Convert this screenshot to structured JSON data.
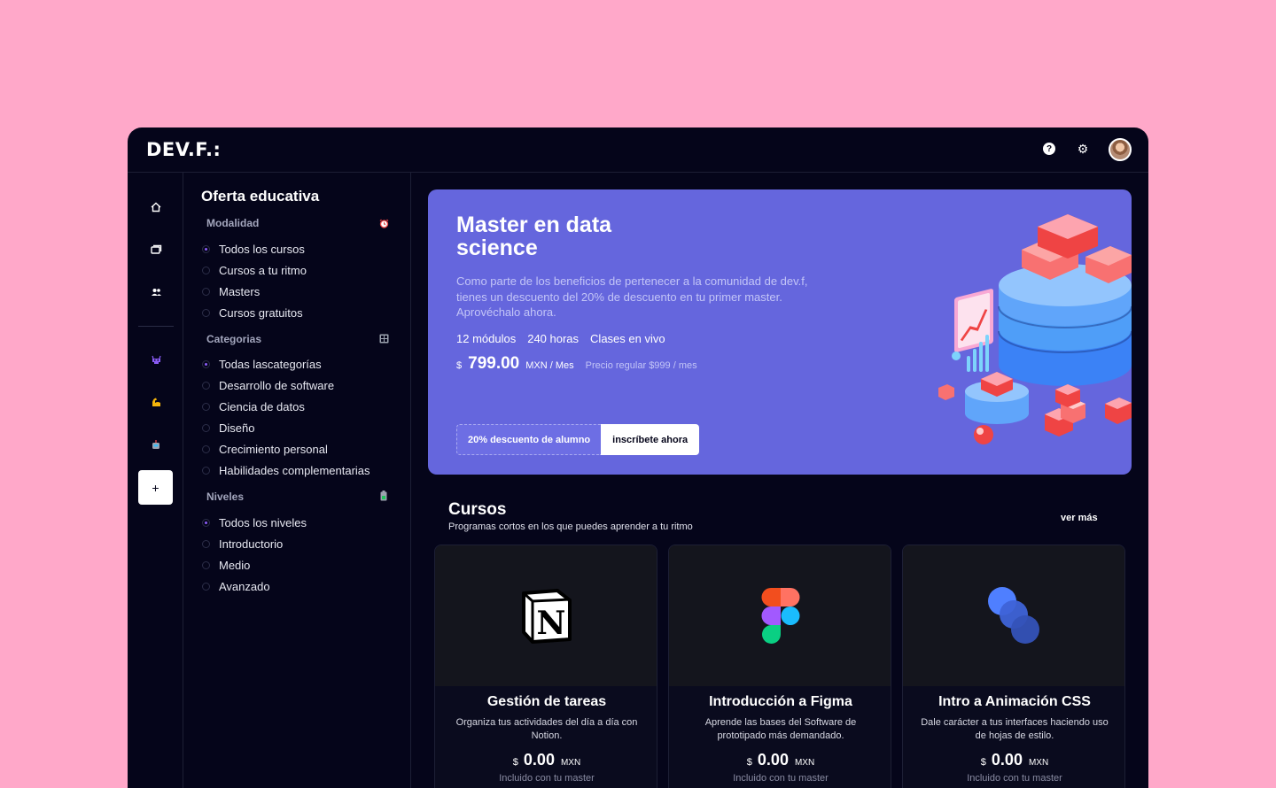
{
  "brand": {
    "logo_text": "DEV.F.:"
  },
  "topbar": {
    "icons": [
      "help-icon",
      "gear-icon",
      "avatar"
    ]
  },
  "rail": {
    "items": [
      "home-icon",
      "courses-icon",
      "community-icon",
      "alien-icon",
      "muscle-icon",
      "robot-icon"
    ],
    "add_label": "+"
  },
  "filters": {
    "title": "Oferta educativa",
    "sections": [
      {
        "label": "Modalidad",
        "icon": "alarm-clock-icon",
        "options": [
          {
            "label": "Todos los cursos",
            "selected": true
          },
          {
            "label": "Cursos a tu ritmo",
            "selected": false
          },
          {
            "label": "Masters",
            "selected": false
          },
          {
            "label": "Cursos gratuitos",
            "selected": false
          }
        ]
      },
      {
        "label": "Categorias",
        "icon": "grid-icon",
        "options": [
          {
            "label": "Todas lascategorías",
            "selected": true
          },
          {
            "label": "Desarrollo de software",
            "selected": false
          },
          {
            "label": "Ciencia de datos",
            "selected": false
          },
          {
            "label": "Diseño",
            "selected": false
          },
          {
            "label": "Crecimiento personal",
            "selected": false
          },
          {
            "label": "Habilidades complementarias",
            "selected": false
          }
        ]
      },
      {
        "label": "Niveles",
        "icon": "battery-icon",
        "options": [
          {
            "label": "Todos los niveles",
            "selected": true
          },
          {
            "label": "Introductorio",
            "selected": false
          },
          {
            "label": "Medio",
            "selected": false
          },
          {
            "label": "Avanzado",
            "selected": false
          }
        ]
      }
    ]
  },
  "hero": {
    "title": "Master en data science",
    "description": "Como parte de los beneficios de pertenecer a la comunidad de dev.f, tienes un descuento del 20% de descuento en tu primer master. Aprovéchalo ahora.",
    "meta": [
      "12 módulos",
      "240 horas",
      "Clases en vivo"
    ],
    "price": {
      "currency_symbol": "$",
      "amount": "799.00",
      "unit": "MXN / Mes",
      "regular": "Precio regular $999 / mes"
    },
    "badge": "20% descuento de alumno",
    "cta": "inscríbete ahora",
    "colors": {
      "background": "#6566dd"
    }
  },
  "courses": {
    "title": "Cursos",
    "subtitle": "Programas cortos en los que puedes aprender a tu ritmo",
    "see_more": "ver más",
    "items": [
      {
        "logo": "notion-logo",
        "title": "Gestión de tareas",
        "description": "Organiza tus actividades del día a día con Notion.",
        "currency_symbol": "$",
        "price": "0.00",
        "unit": "MXN",
        "note": "Incluido con tu master"
      },
      {
        "logo": "figma-logo",
        "title": "Introducción a Figma",
        "description": "Aprende las bases del Software de prototipado más demandado.",
        "currency_symbol": "$",
        "price": "0.00",
        "unit": "MXN",
        "note": "Incluido con tu master"
      },
      {
        "logo": "css-animation-logo",
        "title": "Intro a Animación CSS",
        "description": "Dale carácter a tus interfaces haciendo uso de hojas de estilo.",
        "currency_symbol": "$",
        "price": "0.00",
        "unit": "MXN",
        "note": "Incluido con tu master"
      }
    ]
  }
}
